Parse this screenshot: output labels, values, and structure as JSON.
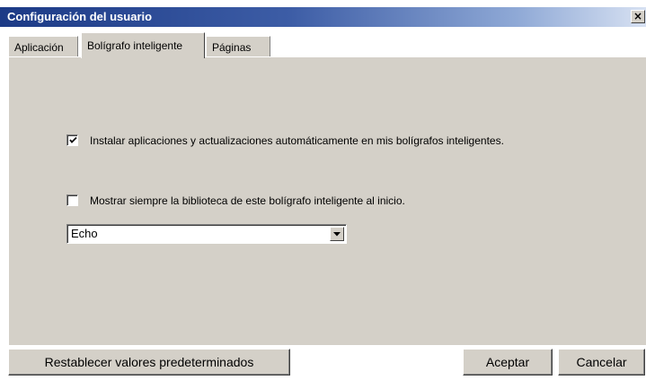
{
  "window": {
    "title": "Configuración del usuario",
    "close_glyph": "×"
  },
  "tabs": [
    {
      "label": "Aplicación",
      "active": false
    },
    {
      "label": "Bolígrafo inteligente",
      "active": true
    },
    {
      "label": "Páginas",
      "active": false
    }
  ],
  "settings": {
    "auto_install": {
      "checked": true,
      "label": "Instalar aplicaciones y actualizaciones automáticamente en mis bolígrafos inteligentes."
    },
    "show_library": {
      "checked": false,
      "label": "Mostrar siempre la biblioteca de este bolígrafo inteligente al inicio."
    },
    "pen_select": {
      "value": "Echo"
    }
  },
  "buttons": {
    "restore": "Restablecer valores predeterminados",
    "ok": "Aceptar",
    "cancel": "Cancelar"
  },
  "icons": {
    "close": "close-icon",
    "checkmark": "checkmark-icon",
    "dropdown": "chevron-down-icon"
  },
  "colors": {
    "face": "#d4d0c8",
    "title_start": "#1c3a86",
    "title_end": "#d7e1f2"
  }
}
